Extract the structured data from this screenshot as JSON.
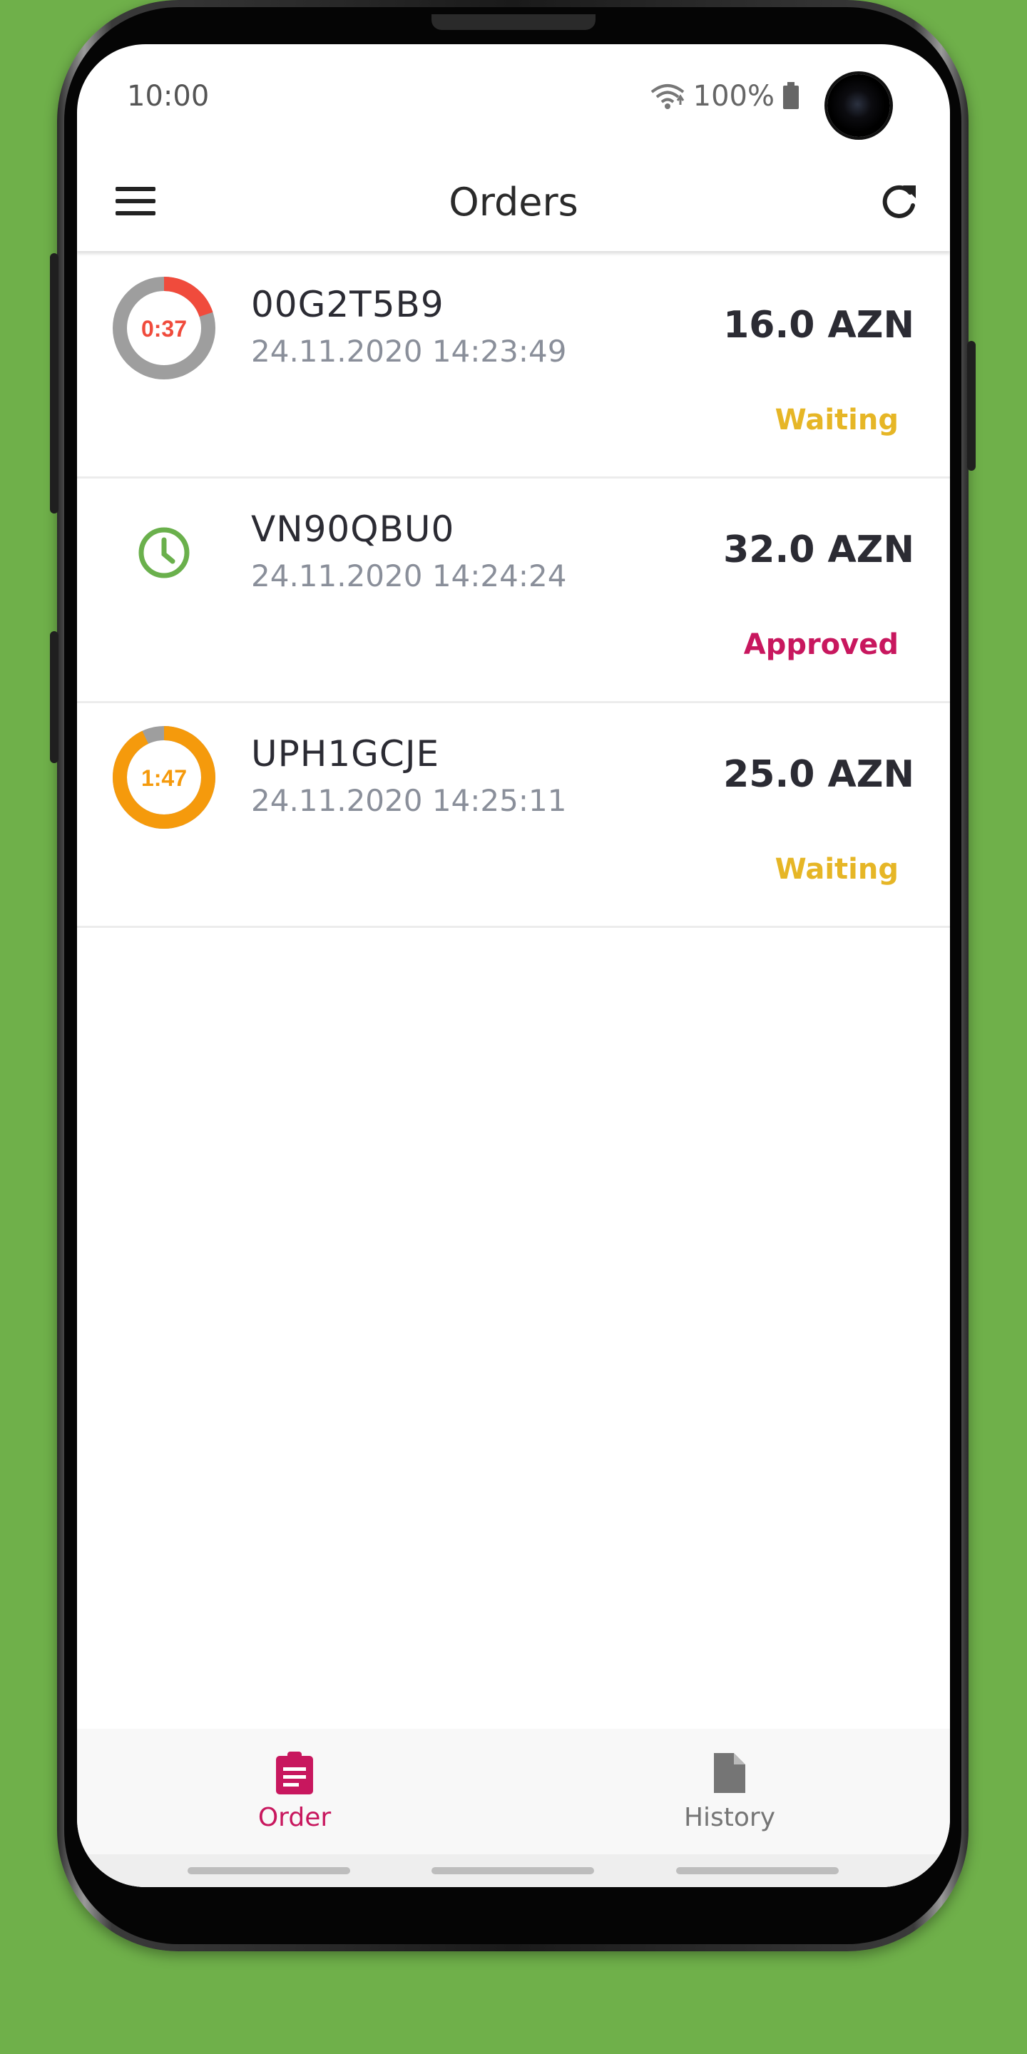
{
  "status_bar": {
    "time": "10:00",
    "battery": "100%"
  },
  "app_bar": {
    "title": "Orders",
    "menu_icon": "hamburger-menu-icon",
    "refresh_icon": "refresh-icon"
  },
  "orders": [
    {
      "id": "00G2T5B9",
      "date": "24.11.2020 14:23:49",
      "price": "16.0 AZN",
      "status": "Waiting",
      "status_color": "#e6b626",
      "timer": "0:37",
      "timer_color": "#f04b3c",
      "timer_remaining_fraction": 0.2,
      "icon": "countdown-ring-icon"
    },
    {
      "id": "VN90QBU0",
      "date": "24.11.2020 14:24:24",
      "price": "32.0 AZN",
      "status": "Approved",
      "status_color": "#c8175e",
      "icon": "clock-icon",
      "icon_color": "#6ab04c"
    },
    {
      "id": "UPH1GCJE",
      "date": "24.11.2020 14:25:11",
      "price": "25.0 AZN",
      "status": "Waiting",
      "status_color": "#e6b626",
      "timer": "1:47",
      "timer_color": "#f59a0c",
      "timer_remaining_fraction": 0.93,
      "icon": "countdown-ring-icon"
    }
  ],
  "bottom_nav": {
    "items": [
      {
        "label": "Order",
        "icon": "clipboard-icon",
        "active": true,
        "color": "#c8175e"
      },
      {
        "label": "History",
        "icon": "document-icon",
        "active": false,
        "color": "#757575"
      }
    ]
  },
  "colors": {
    "background": "#6fb04a",
    "accent": "#c8175e",
    "ring_track": "#9e9e9e"
  }
}
